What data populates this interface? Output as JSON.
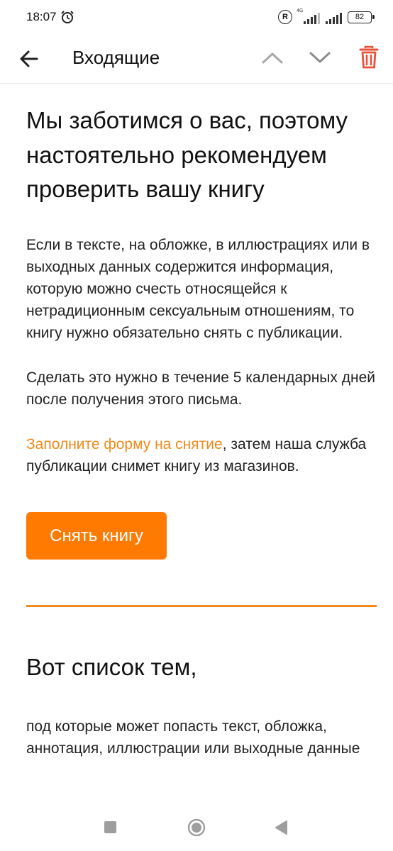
{
  "status_bar": {
    "time": "18:07",
    "network_label": "4G",
    "battery": "82"
  },
  "app_bar": {
    "title": "Входящие",
    "icons": [
      "back-arrow-icon",
      "chevron-up-icon",
      "chevron-down-icon",
      "trash-icon"
    ],
    "colors": {
      "trash": "#e8533a",
      "chevron": "#9e9e9e"
    }
  },
  "email": {
    "headline": "Мы заботимся о вас, поэтому настоятельно рекомендуем проверить вашу книгу",
    "paragraph1": "Если в тексте, на обложке, в иллюстрациях или в выходных данных содержится информация, которую можно счесть относящейся к нетрадиционным сексуальным отношениям, то книгу нужно обязательно снять с публикации.",
    "paragraph2": "Сделать это нужно в течение 5 календарных дней после получения этого письма.",
    "paragraph3_link": "Заполните форму на снятие",
    "paragraph3_rest": ", затем наша служба публикации снимет книгу из магазинов.",
    "button_label": "Снять книгу",
    "section_title": "Вот список тем,",
    "paragraph4": "под которые может попасть текст, обложка, аннотация, иллюстрации или выходные данные",
    "colors": {
      "accent": "#ff7a00",
      "link": "#f08a1c",
      "divider": "#f28a1b"
    }
  },
  "nav_bar": {
    "icons": [
      "recents-square-icon",
      "home-circle-icon",
      "back-triangle-icon"
    ]
  }
}
